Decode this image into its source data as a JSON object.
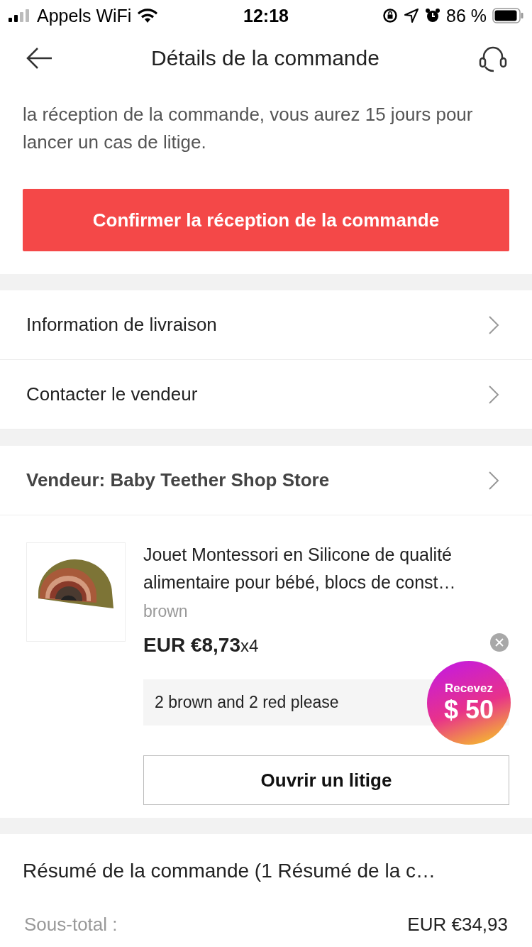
{
  "status_bar": {
    "carrier": "Appels WiFi",
    "time": "12:18",
    "battery": "86 %"
  },
  "header": {
    "title": "Détails de la commande"
  },
  "notice": "la réception de la commande, vous aurez 15 jours pour lancer un cas de litige.",
  "confirm_button": "Confirmer la réception de la commande",
  "links": [
    "Information de livraison",
    "Contacter le vendeur"
  ],
  "seller": "Vendeur: Baby Teether Shop Store",
  "product": {
    "title": "Jouet Montessori en Silicone de qualité alimentaire pour bébé, blocs de const…",
    "variant": "brown",
    "price": "EUR €8,73",
    "quantity": "x4",
    "note": "2 brown and 2 red please"
  },
  "dispute_button": "Ouvrir un litige",
  "promo": {
    "line1": "Recevez",
    "amount": "$ 50"
  },
  "summary": {
    "title": "Résumé de la commande (1 Résumé de la c…",
    "rows": [
      {
        "label": "Sous-total :",
        "value": "EUR €34,93"
      }
    ]
  }
}
